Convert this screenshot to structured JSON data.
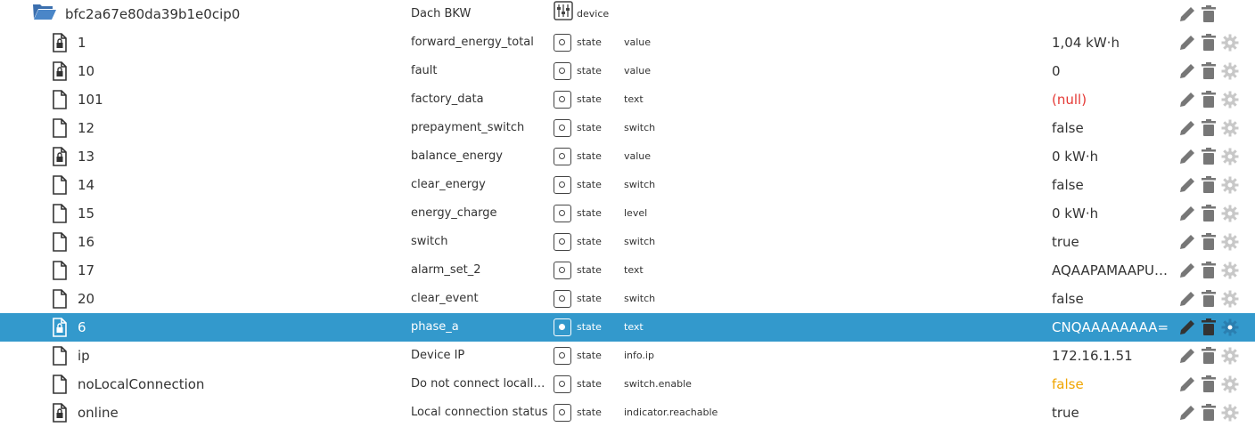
{
  "colors": {
    "selected_bg": "#3399cc",
    "null_value": "#e53935",
    "warning_value": "#f0a500",
    "icon_gray": "#777777",
    "icon_light": "#c8c8c8"
  },
  "root": {
    "id": "bfc2a67e80da39b1e0cip0",
    "name": "Dach BKW",
    "type": "device",
    "icon": "folder-open-icon"
  },
  "rows": [
    {
      "id": "1",
      "name": "forward_energy_total",
      "type": "state",
      "role": "value",
      "value": "1,04 kW·h",
      "icon": "file-lock-icon",
      "value_style": "normal",
      "selected": false
    },
    {
      "id": "10",
      "name": "fault",
      "type": "state",
      "role": "value",
      "value": "0",
      "icon": "file-lock-icon",
      "value_style": "normal",
      "selected": false
    },
    {
      "id": "101",
      "name": "factory_data",
      "type": "state",
      "role": "text",
      "value": "(null)",
      "icon": "file-icon",
      "value_style": "null",
      "selected": false
    },
    {
      "id": "12",
      "name": "prepayment_switch",
      "type": "state",
      "role": "switch",
      "value": "false",
      "icon": "file-icon",
      "value_style": "normal",
      "selected": false
    },
    {
      "id": "13",
      "name": "balance_energy",
      "type": "state",
      "role": "value",
      "value": "0 kW·h",
      "icon": "file-lock-icon",
      "value_style": "normal",
      "selected": false
    },
    {
      "id": "14",
      "name": "clear_energy",
      "type": "state",
      "role": "switch",
      "value": "false",
      "icon": "file-icon",
      "value_style": "normal",
      "selected": false
    },
    {
      "id": "15",
      "name": "energy_charge",
      "type": "state",
      "role": "level",
      "value": "0 kW·h",
      "icon": "file-icon",
      "value_style": "normal",
      "selected": false
    },
    {
      "id": "16",
      "name": "switch",
      "type": "state",
      "role": "switch",
      "value": "true",
      "icon": "file-icon",
      "value_style": "normal",
      "selected": false
    },
    {
      "id": "17",
      "name": "alarm_set_2",
      "type": "state",
      "role": "text",
      "value": "AQAAPAMAAPUE...",
      "icon": "file-icon",
      "value_style": "normal",
      "selected": false
    },
    {
      "id": "20",
      "name": "clear_event",
      "type": "state",
      "role": "switch",
      "value": "false",
      "icon": "file-icon",
      "value_style": "normal",
      "selected": false
    },
    {
      "id": "6",
      "name": "phase_a",
      "type": "state",
      "role": "text",
      "value": "CNQAAAAAAAA=",
      "icon": "file-lock-icon",
      "value_style": "normal",
      "selected": true
    },
    {
      "id": "ip",
      "name": "Device IP",
      "type": "state",
      "role": "info.ip",
      "value": "172.16.1.51",
      "icon": "file-icon",
      "value_style": "normal",
      "selected": false
    },
    {
      "id": "noLocalConnection",
      "name": "Do not connect locally t...",
      "type": "state",
      "role": "switch.enable",
      "value": "false",
      "icon": "file-icon",
      "value_style": "warning",
      "selected": false
    },
    {
      "id": "online",
      "name": "Local connection status",
      "type": "state",
      "role": "indicator.reachable",
      "value": "true",
      "icon": "file-lock-icon",
      "value_style": "normal",
      "selected": false
    }
  ]
}
